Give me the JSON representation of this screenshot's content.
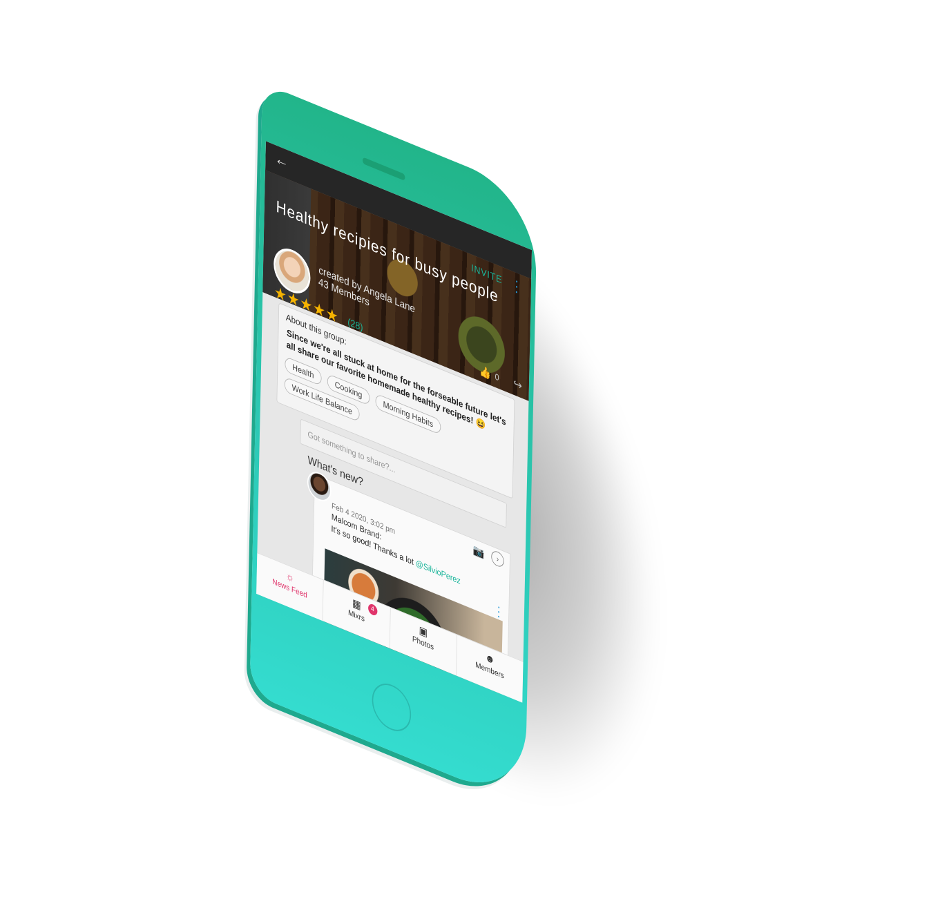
{
  "header": {
    "back_icon": "arrow-left-icon",
    "invite_label": "INVITE",
    "menu_icon": "kebab-vertical-icon"
  },
  "group": {
    "title": "Healthy recipies for busy people",
    "created_by": "created by Angela Lane",
    "members": "43 Members",
    "rating_stars": "★★★★★",
    "rating_count": "(28)",
    "likes": "0"
  },
  "about": {
    "label": "About this group:",
    "text": "Since we're all stuck at home for the forseable future let's all share our favorite homemade healthy recipes!",
    "emoji": "😆",
    "tags": [
      "Health",
      "Cooking",
      "Morning Habits",
      "Work Life Balance"
    ]
  },
  "composer": {
    "placeholder": "Got something to share?..."
  },
  "feed": {
    "heading": "What's new?",
    "post": {
      "date": "Feb 4 2020, 3:02 pm",
      "author": "Malcom Brand:",
      "text": "It's so good! Thanks a lot ",
      "mention": "@SilvioPerez"
    }
  },
  "tabs": [
    {
      "label": "News Feed",
      "icon": "sun-icon"
    },
    {
      "label": "Mixrs",
      "icon": "calendar-icon",
      "badge": "4"
    },
    {
      "label": "Photos",
      "icon": "photo-icon"
    },
    {
      "label": "Members",
      "icon": "members-icon"
    }
  ],
  "colors": {
    "brand": "#19b59a",
    "phone_body": "#2cc8b4",
    "accent": "#e0356b",
    "star": "#f5b300",
    "link": "#2b9bd8"
  }
}
